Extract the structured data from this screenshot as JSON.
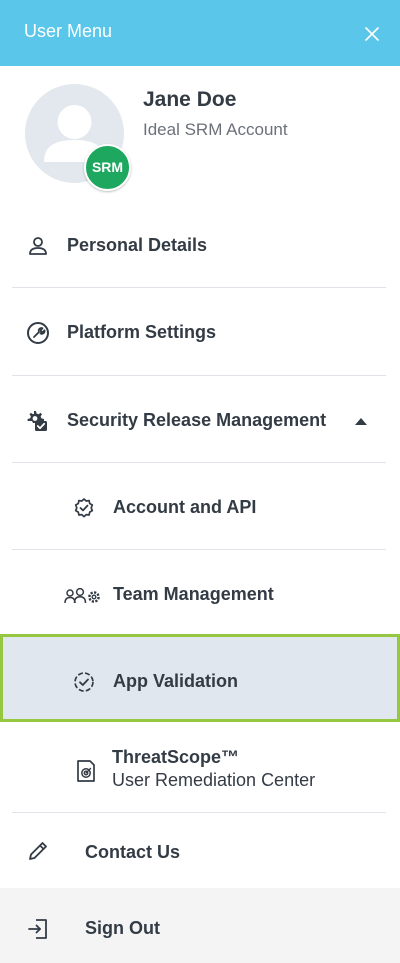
{
  "header": {
    "title": "User Menu"
  },
  "profile": {
    "name": "Jane Doe",
    "account": "Ideal SRM Account",
    "badge": "SRM"
  },
  "menu": {
    "personal_details": "Personal Details",
    "platform_settings": "Platform Settings",
    "security_release_management": "Security Release Management",
    "account_api": "Account and API",
    "team_management": "Team Management",
    "app_validation": "App Validation",
    "threatscope_title": "ThreatScope™",
    "threatscope_subtitle": "User Remediation Center",
    "contact_us": "Contact Us",
    "sign_out": "Sign Out"
  },
  "colors": {
    "header_bg": "#5ac6ea",
    "selected_bg": "#e1e7ef",
    "selected_border": "#95c740",
    "badge_bg": "#1ea85f"
  }
}
